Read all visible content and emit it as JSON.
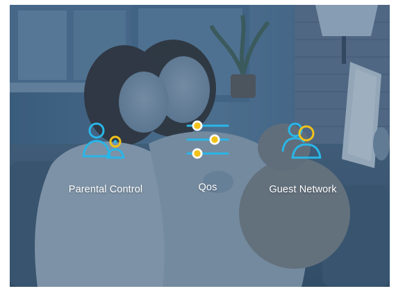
{
  "colors": {
    "icon_blue": "#29b6e8",
    "icon_yellow": "#f2c21b",
    "overlay": "#1c4266",
    "label_text": "#ffffff"
  },
  "features": [
    {
      "id": "parental",
      "label": "Parental Control",
      "icon": "parental-control-icon"
    },
    {
      "id": "qos",
      "label": "Qos",
      "icon": "qos-sliders-icon"
    },
    {
      "id": "guest",
      "label": "Guest Network",
      "icon": "guest-network-icon"
    }
  ]
}
